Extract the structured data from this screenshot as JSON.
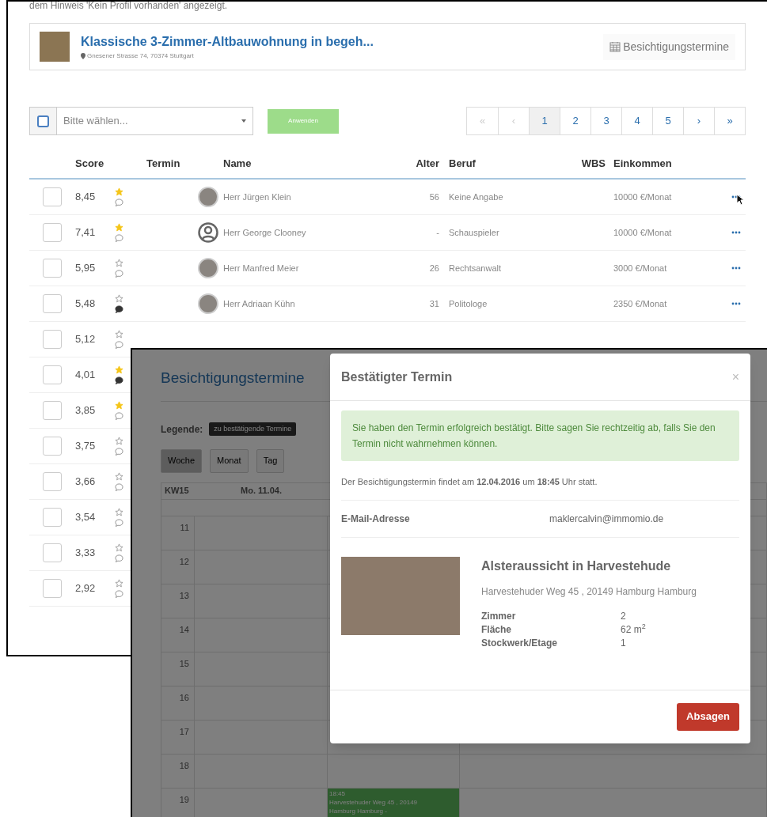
{
  "listing_page": {
    "intro_text": "dem Hinweis 'Kein Profil vorhanden' angezeigt.",
    "listing": {
      "title": "Klassische 3-Zimmer-Altbauwohnung in begeh...",
      "address": "Gnesener Strasse 74, 70374 Stuttgart",
      "appointments_button": "Besichtigungstermine"
    },
    "bulk_action": {
      "checked": false,
      "placeholder": "Bitte wählen...",
      "apply_button": "Anwenden"
    },
    "pagination": [
      {
        "label": "«",
        "selected": false,
        "disabled": true
      },
      {
        "label": "‹",
        "selected": false,
        "disabled": true
      },
      {
        "label": "1",
        "selected": true,
        "disabled": false
      },
      {
        "label": "2",
        "selected": false,
        "disabled": false
      },
      {
        "label": "3",
        "selected": false,
        "disabled": false
      },
      {
        "label": "4",
        "selected": false,
        "disabled": false
      },
      {
        "label": "5",
        "selected": false,
        "disabled": false
      },
      {
        "label": "›",
        "selected": false,
        "disabled": false
      },
      {
        "label": "»",
        "selected": false,
        "disabled": false
      }
    ],
    "table": {
      "columns": [
        "Score",
        "Termin",
        "Name",
        "Alter",
        "Beruf",
        "WBS",
        "Einkommen"
      ],
      "rows": [
        {
          "checked": false,
          "score": "8,45",
          "starred": true,
          "comment_filled": false,
          "avatar": {
            "kind": "photo"
          },
          "name": "Herr Jürgen Klein",
          "age": "56",
          "profession": "Keine Angabe",
          "income": "10000 €/Monat"
        },
        {
          "checked": false,
          "score": "7,41",
          "starred": true,
          "comment_filled": false,
          "avatar": {
            "kind": "silhouette"
          },
          "name": "Herr George Clooney",
          "age": "-",
          "profession": "Schauspieler",
          "income": "10000 €/Monat"
        },
        {
          "checked": false,
          "score": "5,95",
          "starred": false,
          "comment_filled": false,
          "avatar": {
            "kind": "photo"
          },
          "name": "Herr Manfred Meier",
          "age": "26",
          "profession": "Rechtsanwalt",
          "income": "3000 €/Monat"
        },
        {
          "checked": false,
          "score": "5,48",
          "starred": false,
          "comment_filled": true,
          "avatar": {
            "kind": "photo"
          },
          "name": "Herr Adriaan Kühn",
          "age": "31",
          "profession": "Politologe",
          "income": "2350 €/Monat"
        },
        {
          "checked": false,
          "score": "5,12",
          "starred": false,
          "comment_filled": false
        },
        {
          "checked": false,
          "score": "4,01",
          "starred": true,
          "comment_filled": true
        },
        {
          "checked": false,
          "score": "3,85",
          "starred": true,
          "comment_filled": false
        },
        {
          "checked": false,
          "score": "3,75",
          "starred": false,
          "comment_filled": false
        },
        {
          "checked": false,
          "score": "3,66",
          "starred": false,
          "comment_filled": false
        },
        {
          "checked": false,
          "score": "3,54",
          "starred": false,
          "comment_filled": false
        },
        {
          "checked": false,
          "score": "3,33",
          "starred": false,
          "comment_filled": false
        },
        {
          "checked": false,
          "score": "2,92",
          "starred": false,
          "comment_filled": false
        }
      ]
    }
  },
  "calendar_page": {
    "title": "Besichtigungstermine",
    "legend_label": "Legende:",
    "legend_badge": "zu bestätigende Termine",
    "views": [
      {
        "label": "Woche",
        "selected": true
      },
      {
        "label": "Monat",
        "selected": false
      },
      {
        "label": "Tag",
        "selected": false
      }
    ],
    "week_label": "KW15",
    "day_header": "Mo. 11.04.",
    "hours": [
      {
        "label": "11"
      },
      {
        "label": "12"
      },
      {
        "label": "13"
      },
      {
        "label": "14"
      },
      {
        "label": "15"
      },
      {
        "label": "16"
      },
      {
        "label": "17"
      },
      {
        "label": "18"
      },
      {
        "label": "19",
        "event": {
          "lines": [
            "18:45",
            "Harvestehuder Weg 45 , 20149",
            "Hamburg Hamburg -"
          ]
        }
      }
    ]
  },
  "modal": {
    "title": "Bestätigter Termin",
    "close": "×",
    "alert": "Sie haben den Termin erfolgreich bestätigt. Bitte sagen Sie rechtzeitig ab, falls Sie den Termin nicht wahrnehmen können.",
    "info": "Der Besichtigungstermin findet am **12.04.2016** um **18:45** Uhr statt.",
    "email_label": "E-Mail-Adresse",
    "email": "maklercalvin@immomio.de",
    "property": {
      "title": "Alsteraussicht in Harvestehude",
      "address": "Harvestehuder Weg 45 , 20149 Hamburg Hamburg",
      "facts": [
        {
          "label": "Zimmer",
          "value": "2"
        },
        {
          "label": "Fläche",
          "value": "62 m$^{2}$"
        },
        {
          "label": "Stockwerk/Etage",
          "value": "1"
        }
      ]
    },
    "cancel_button": "Absagen"
  }
}
